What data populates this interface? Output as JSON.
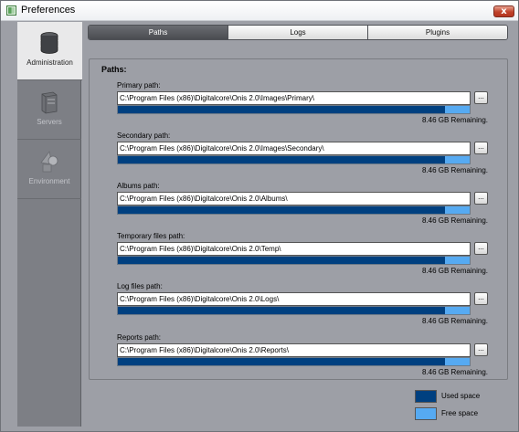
{
  "window": {
    "title": "Preferences",
    "close_label": "x"
  },
  "sidebar": {
    "items": [
      {
        "label": "Administration",
        "icon": "database-icon",
        "active": true
      },
      {
        "label": "Servers",
        "icon": "server-icon",
        "active": false
      },
      {
        "label": "Environment",
        "icon": "shapes-icon",
        "active": false
      }
    ]
  },
  "tabs": [
    {
      "label": "Paths",
      "active": true
    },
    {
      "label": "Logs",
      "active": false
    },
    {
      "label": "Plugins",
      "active": false
    }
  ],
  "paths_group": {
    "title": "Paths:",
    "browse_label": "...",
    "items": [
      {
        "label": "Primary path:",
        "value": "C:\\Program Files (x86)\\Digitalcore\\Onis 2.0\\Images\\Primary\\",
        "used_fraction": 0.93,
        "remaining": "8.46 GB Remaining."
      },
      {
        "label": "Secondary path:",
        "value": "C:\\Program Files (x86)\\Digitalcore\\Onis 2.0\\Images\\Secondary\\",
        "used_fraction": 0.93,
        "remaining": "8.46 GB Remaining."
      },
      {
        "label": "Albums path:",
        "value": "C:\\Program Files (x86)\\Digitalcore\\Onis 2.0\\Albums\\",
        "used_fraction": 0.93,
        "remaining": "8.46 GB Remaining."
      },
      {
        "label": "Temporary files path:",
        "value": "C:\\Program Files (x86)\\Digitalcore\\Onis 2.0\\Temp\\",
        "used_fraction": 0.93,
        "remaining": "8.46 GB Remaining."
      },
      {
        "label": "Log files path:",
        "value": "C:\\Program Files (x86)\\Digitalcore\\Onis 2.0\\Logs\\",
        "used_fraction": 0.93,
        "remaining": "8.46 GB Remaining."
      },
      {
        "label": "Reports path:",
        "value": "C:\\Program Files (x86)\\Digitalcore\\Onis 2.0\\Reports\\",
        "used_fraction": 0.93,
        "remaining": "8.46 GB Remaining."
      }
    ]
  },
  "legend": {
    "used": {
      "label": "Used space",
      "color": "#004080"
    },
    "free": {
      "label": "Free space",
      "color": "#56aaf2"
    }
  }
}
